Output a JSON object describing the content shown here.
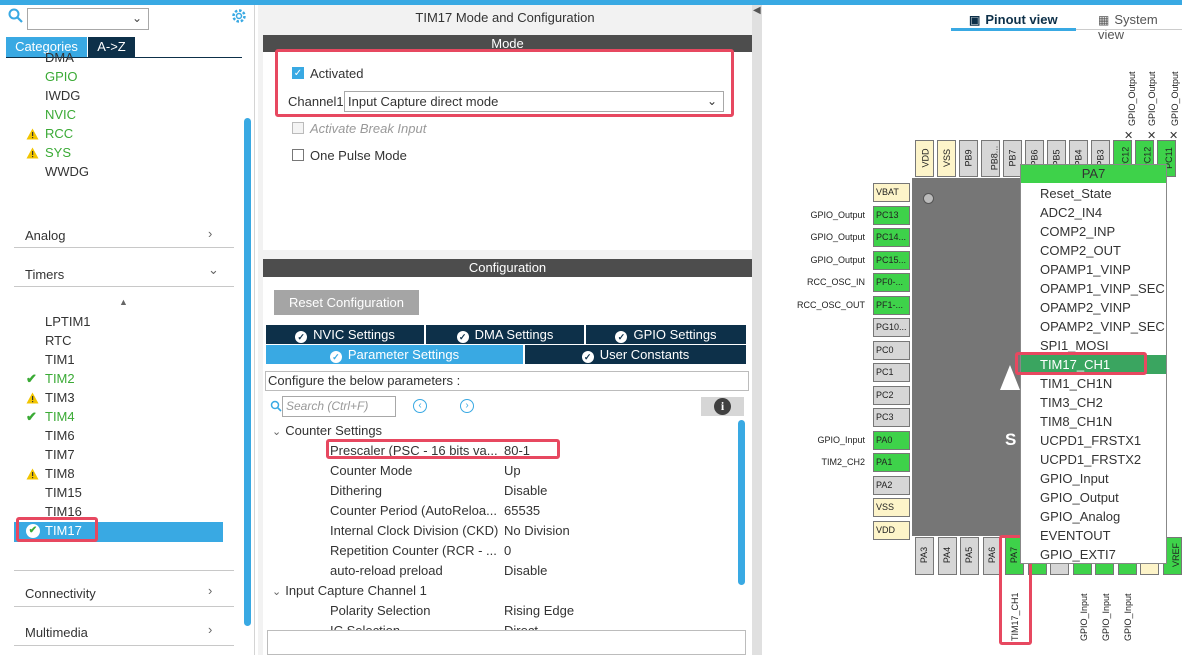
{
  "left": {
    "tabs": {
      "categories": "Categories",
      "az": "A->Z"
    },
    "sys_items": [
      {
        "label": "DMA",
        "status": "none",
        "cls": ""
      },
      {
        "label": "GPIO",
        "status": "none",
        "cls": "green"
      },
      {
        "label": "IWDG",
        "status": "none",
        "cls": ""
      },
      {
        "label": "NVIC",
        "status": "none",
        "cls": "green"
      },
      {
        "label": "RCC",
        "status": "warning",
        "cls": "green"
      },
      {
        "label": "SYS",
        "status": "warning",
        "cls": "green"
      },
      {
        "label": "WWDG",
        "status": "none",
        "cls": ""
      }
    ],
    "sections": {
      "analog": "Analog",
      "timers": "Timers",
      "connectivity": "Connectivity",
      "multimedia": "Multimedia"
    },
    "timer_items": [
      {
        "label": "LPTIM1",
        "status": "none"
      },
      {
        "label": "RTC",
        "status": "none"
      },
      {
        "label": "TIM1",
        "status": "none"
      },
      {
        "label": "TIM2",
        "status": "check"
      },
      {
        "label": "TIM3",
        "status": "warning"
      },
      {
        "label": "TIM4",
        "status": "check"
      },
      {
        "label": "TIM6",
        "status": "none"
      },
      {
        "label": "TIM7",
        "status": "none"
      },
      {
        "label": "TIM8",
        "status": "warning"
      },
      {
        "label": "TIM15",
        "status": "none"
      },
      {
        "label": "TIM16",
        "status": "none"
      },
      {
        "label": "TIM17",
        "status": "check-selected"
      }
    ]
  },
  "mid": {
    "title": "TIM17 Mode and Configuration",
    "mode_header": "Mode",
    "activated": "Activated",
    "channel1_label": "Channel1",
    "channel1_value": "Input Capture direct mode",
    "activate_break": "Activate Break Input",
    "one_pulse": "One Pulse Mode",
    "config_header": "Configuration",
    "reset_button": "Reset Configuration",
    "tabs": {
      "nvic": "NVIC Settings",
      "dma": "DMA Settings",
      "gpio": "GPIO Settings",
      "param": "Parameter Settings",
      "user": "User Constants"
    },
    "config_hint": "Configure the below parameters :",
    "search_placeholder": "Search (Ctrl+F)",
    "counter_group": "Counter Settings",
    "params": [
      {
        "name": "Prescaler (PSC - 16 bits va...",
        "value": "80-1"
      },
      {
        "name": "Counter Mode",
        "value": "Up"
      },
      {
        "name": "Dithering",
        "value": "Disable"
      },
      {
        "name": "Counter Period (AutoReloa...",
        "value": "65535"
      },
      {
        "name": "Internal Clock Division (CKD)",
        "value": "No Division"
      },
      {
        "name": "Repetition Counter (RCR - ...",
        "value": "0"
      },
      {
        "name": "auto-reload preload",
        "value": "Disable"
      }
    ],
    "ic_group": "Input Capture Channel 1",
    "ic_params": [
      {
        "name": "Polarity Selection",
        "value": "Rising Edge"
      },
      {
        "name": "IC Selection",
        "value": "Direct"
      }
    ]
  },
  "right": {
    "pinout_tab": "Pinout view",
    "system_tab": "System view",
    "left_pins": [
      {
        "label": "VBAT",
        "color": "y",
        "signal": ""
      },
      {
        "label": "PC13",
        "color": "g",
        "signal": "GPIO_Output"
      },
      {
        "label": "PC14...",
        "color": "g",
        "signal": "GPIO_Output"
      },
      {
        "label": "PC15...",
        "color": "g",
        "signal": "GPIO_Output"
      },
      {
        "label": "PF0-...",
        "color": "g",
        "signal": "RCC_OSC_IN"
      },
      {
        "label": "PF1-...",
        "color": "g",
        "signal": "RCC_OSC_OUT"
      },
      {
        "label": "PG10...",
        "color": "gr",
        "signal": ""
      },
      {
        "label": "PC0",
        "color": "gr",
        "signal": ""
      },
      {
        "label": "PC1",
        "color": "gr",
        "signal": ""
      },
      {
        "label": "PC2",
        "color": "gr",
        "signal": ""
      },
      {
        "label": "PC3",
        "color": "gr",
        "signal": ""
      },
      {
        "label": "PA0",
        "color": "g",
        "signal": "GPIO_Input"
      },
      {
        "label": "PA1",
        "color": "g",
        "signal": "TIM2_CH2"
      },
      {
        "label": "PA2",
        "color": "gr",
        "signal": ""
      },
      {
        "label": "VSS",
        "color": "y",
        "signal": ""
      },
      {
        "label": "VDD",
        "color": "y",
        "signal": ""
      }
    ],
    "top_pins": [
      {
        "label": "VDD",
        "color": "y"
      },
      {
        "label": "VSS",
        "color": "y"
      },
      {
        "label": "PB9",
        "color": "gr"
      },
      {
        "label": "PB8...",
        "color": "gr"
      },
      {
        "label": "PB7",
        "color": "gr"
      },
      {
        "label": "PB6",
        "color": "gr"
      },
      {
        "label": "PB5",
        "color": "gr"
      },
      {
        "label": "PB4",
        "color": "gr"
      },
      {
        "label": "PB3",
        "color": "gr"
      },
      {
        "label": "PC12",
        "color": "g"
      },
      {
        "label": "PC12",
        "color": "g"
      },
      {
        "label": "PC11",
        "color": "g"
      }
    ],
    "top_signals": [
      "GPIO_Output",
      "GPIO_Output",
      "GPIO_Output"
    ],
    "bottom_pins": [
      {
        "label": "PA3",
        "color": "gr"
      },
      {
        "label": "PA4",
        "color": "gr"
      },
      {
        "label": "PA5",
        "color": "gr"
      },
      {
        "label": "PA6",
        "color": "gr"
      },
      {
        "label": "PA7",
        "color": "g"
      },
      {
        "label": "P",
        "color": "g"
      },
      {
        "label": "P",
        "color": "gr"
      },
      {
        "label": "P",
        "color": "g"
      },
      {
        "label": "P",
        "color": "g"
      },
      {
        "label": "P",
        "color": "g"
      },
      {
        "label": "V",
        "color": "y"
      },
      {
        "label": "VREF",
        "color": "g"
      }
    ],
    "bottom_signals": {
      "tim17": "TIM17_CH1",
      "gpio1": "GPIO_Input",
      "gpio2": "GPIO_Input",
      "gpio3": "GPIO_Input"
    },
    "chip_text_left": "S",
    "chip_text_right": "x",
    "dropdown_header": "PA7",
    "dropdown_items": [
      "Reset_State",
      "ADC2_IN4",
      "COMP2_INP",
      "COMP2_OUT",
      "OPAMP1_VINP",
      "OPAMP1_VINP_SEC",
      "OPAMP2_VINP",
      "OPAMP2_VINP_SEC",
      "SPI1_MOSI",
      "TIM17_CH1",
      "TIM1_CH1N",
      "TIM3_CH2",
      "TIM8_CH1N",
      "UCPD1_FRSTX1",
      "UCPD1_FRSTX2",
      "GPIO_Input",
      "GPIO_Output",
      "GPIO_Analog",
      "EVENTOUT",
      "GPIO_EXTI7"
    ],
    "dropdown_selected": "TIM17_CH1"
  }
}
